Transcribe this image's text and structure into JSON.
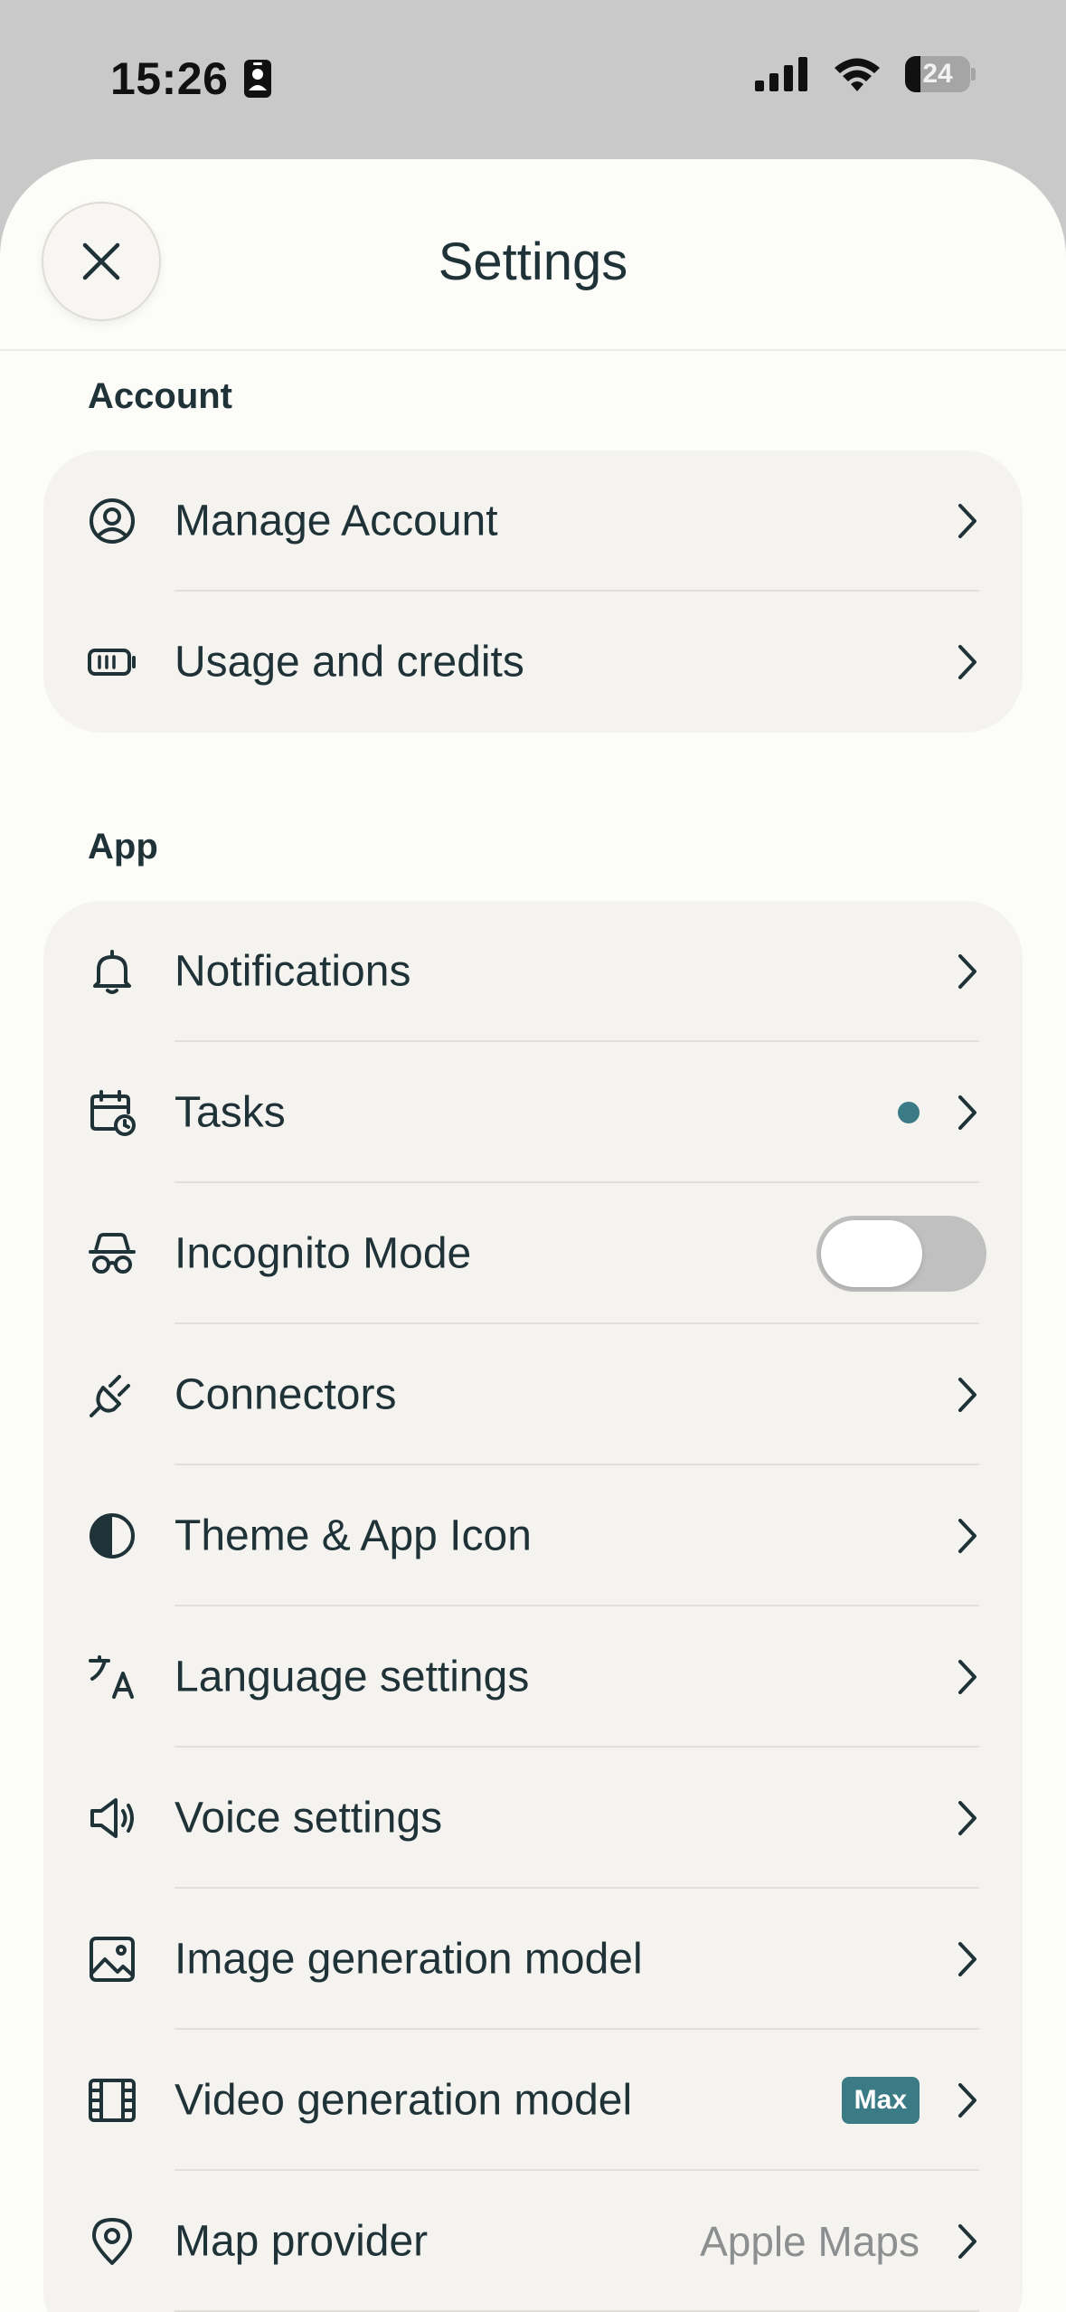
{
  "status_bar": {
    "time": "15:26",
    "battery_level": "24",
    "battery_fraction": 0.24
  },
  "header": {
    "title": "Settings",
    "close_icon": "close-icon"
  },
  "sections": {
    "account": {
      "label": "Account",
      "items": [
        {
          "label": "Manage Account",
          "icon": "user-circle-icon"
        },
        {
          "label": "Usage and credits",
          "icon": "battery-icon"
        }
      ]
    },
    "app": {
      "label": "App",
      "items": [
        {
          "label": "Notifications",
          "icon": "bell-icon"
        },
        {
          "label": "Tasks",
          "icon": "calendar-clock-icon"
        },
        {
          "label": "Incognito Mode",
          "icon": "incognito-icon",
          "toggle": false
        },
        {
          "label": "Connectors",
          "icon": "plug-icon"
        },
        {
          "label": "Theme & App Icon",
          "icon": "contrast-icon"
        },
        {
          "label": "Language settings",
          "icon": "translate-icon"
        },
        {
          "label": "Voice settings",
          "icon": "speaker-icon"
        },
        {
          "label": "Image generation model",
          "icon": "image-icon"
        },
        {
          "label": "Video generation model",
          "icon": "film-icon",
          "badge": "Max"
        },
        {
          "label": "Map provider",
          "icon": "map-pin-icon",
          "value": "Apple Maps"
        }
      ]
    }
  },
  "colors": {
    "accent": "#3b7b86",
    "text": "#1f3237",
    "sheet_bg": "#fcfcf9",
    "group_bg": "#f5f3ef"
  }
}
